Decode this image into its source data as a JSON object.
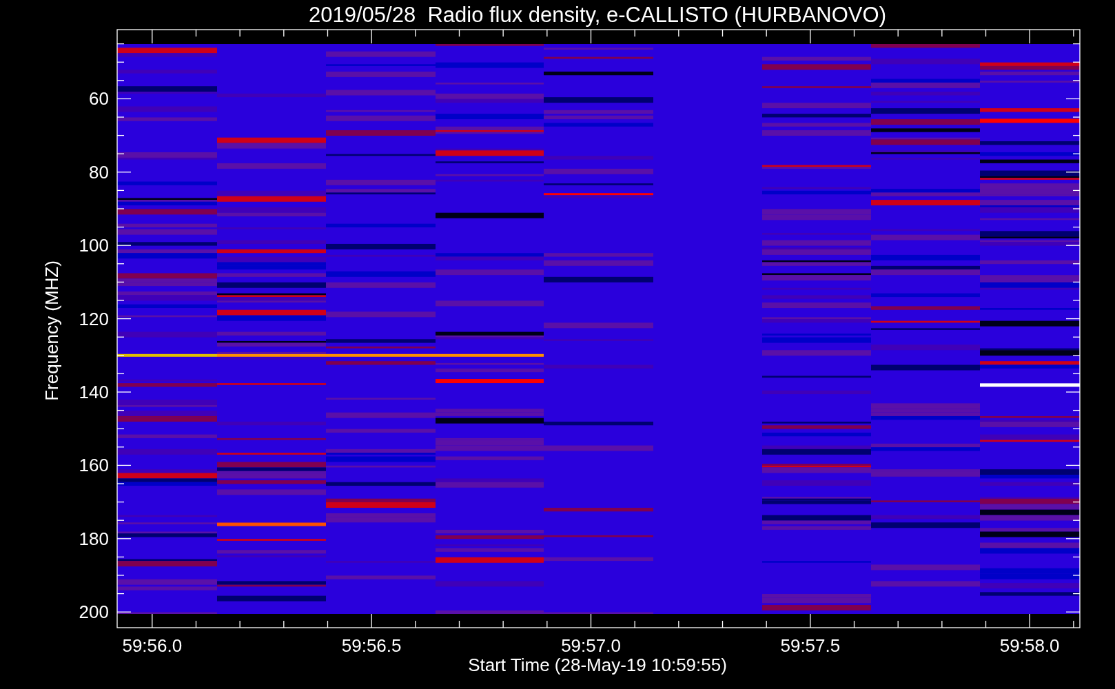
{
  "title": "2019/05/28  Radio flux density, e-CALLISTO (HURBANOVO)",
  "y_axis": {
    "label": "Frequency (MHZ)",
    "ticks": [
      "60",
      "80",
      "100",
      "120",
      "140",
      "160",
      "180",
      "200"
    ]
  },
  "x_axis": {
    "label": "Start Time (28-May-19 10:59:55)",
    "ticks": [
      "59:56.0",
      "59:56.5",
      "59:57.0",
      "59:57.5",
      "59:58.0"
    ]
  }
}
